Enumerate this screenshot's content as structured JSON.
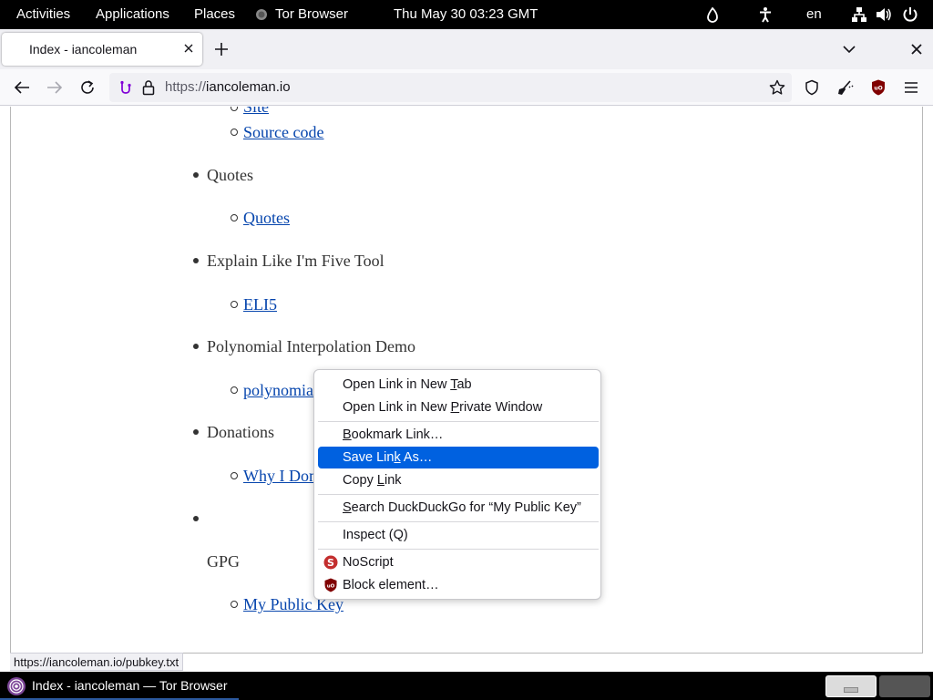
{
  "system_bar": {
    "activities": "Activities",
    "applications": "Applications",
    "places": "Places",
    "app_name": "Tor Browser",
    "datetime": "Thu May 30  03:23 GMT",
    "language": "en"
  },
  "browser": {
    "tab_title": "Index - iancoleman",
    "url_scheme": "https://",
    "url_host": "iancoleman.io"
  },
  "page": {
    "partial_link_top": "Site",
    "sections": [
      {
        "heading": "",
        "links": [
          "Source code"
        ]
      },
      {
        "heading": "Quotes",
        "links": [
          "Quotes"
        ]
      },
      {
        "heading": "Explain Like I'm Five Tool",
        "links": [
          "ELI5"
        ]
      },
      {
        "heading": "Polynomial Interpolation Demo",
        "links": [
          "polynomial"
        ]
      },
      {
        "heading": "Donations",
        "links": [
          "Why I Don"
        ]
      },
      {
        "heading": "GPG",
        "links": [
          "My Public Key"
        ]
      }
    ]
  },
  "status_url": "https://iancoleman.io/pubkey.txt",
  "context_menu": {
    "items": [
      {
        "pre": "Open Link in New ",
        "key": "T",
        "post": "ab"
      },
      {
        "pre": "Open Link in New ",
        "key": "P",
        "post": "rivate Window"
      },
      {
        "pre": "",
        "key": "B",
        "post": "ookmark Link…"
      },
      {
        "pre": "Save Lin",
        "key": "k",
        "post": " As…"
      },
      {
        "pre": "Copy ",
        "key": "L",
        "post": "ink"
      },
      {
        "pre": "",
        "key": "S",
        "post": "earch DuckDuckGo for “My Public Key”"
      },
      {
        "pre": "Inspect (Q)",
        "key": "",
        "post": ""
      },
      {
        "pre": "NoScript",
        "key": "",
        "post": ""
      },
      {
        "pre": "Block element…",
        "key": "",
        "post": ""
      }
    ],
    "selected_index": 3
  },
  "taskbar": {
    "window_title": "Index - iancoleman — Tor Browser"
  },
  "colors": {
    "link": "#0645ad",
    "menu_highlight": "#0061e0",
    "taskbar_accent": "#2c5aa0"
  }
}
